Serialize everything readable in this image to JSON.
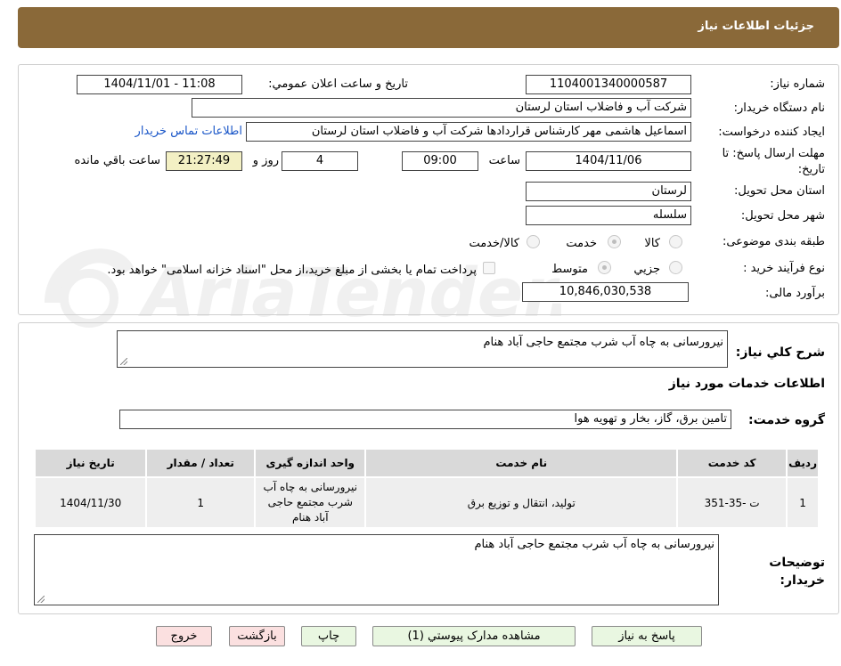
{
  "header": {
    "title": "جزئیات اطلاعات نیاز"
  },
  "form": {
    "need_number_label": "شماره نیاز:",
    "need_number": "1104001340000587",
    "announce_label": "تاریخ و ساعت اعلان عمومي:",
    "announce_value": "1404/11/01 - 11:08",
    "buyer_org_label": "نام دستگاه خریدار:",
    "buyer_org": "شرکت آب و فاضلاب استان لرستان",
    "creator_label": "ایجاد کننده درخواست:",
    "creator": "اسماعیل هاشمی مهر کارشناس قراردادها شرکت آب و فاضلاب استان لرستان",
    "contact_link": "اطلاعات تماس خریدار",
    "deadline_label": "مهلت ارسال پاسخ: تا تاریخ:",
    "deadline_date": "1404/11/06",
    "time_label": "ساعت",
    "deadline_time": "09:00",
    "days": "4",
    "days_label": "روز و",
    "remaining": "21:27:49",
    "remaining_label": "ساعت باقي مانده",
    "province_label": "استان محل تحویل:",
    "province": "لرستان",
    "city_label": "شهر محل تحویل:",
    "city": "سلسله",
    "category_label": "طبقه بندی موضوعی:",
    "category_options": [
      "کالا",
      "خدمت",
      "کالا/خدمت"
    ],
    "category_selected": "خدمت",
    "process_label": "نوع فرآیند خرید :",
    "process_options": [
      "جزیي",
      "متوسط"
    ],
    "process_selected": "متوسط",
    "payment_note": "پرداخت تمام یا بخشی از مبلغ خرید،از محل \"اسناد خزانه اسلامی\" خواهد بود.",
    "budget_label": "برآورد مالی:",
    "budget": "10,846,030,538"
  },
  "summary": {
    "label": "شرح کلي نیاز:",
    "text": "نیرورسانی به چاه آب شرب مجتمع حاجی آباد هنام"
  },
  "services": {
    "section_title": "اطلاعات خدمات مورد نیاز",
    "group_label": "گروه خدمت:",
    "group_value": "تامین برق، گاز، بخار و تهویه هوا",
    "columns": [
      "ردیف",
      "کد خدمت",
      "نام خدمت",
      "واحد اندازه گیری",
      "تعداد / مقدار",
      "تاریخ نیاز"
    ],
    "rows": [
      {
        "row": "1",
        "code": "ت -35-351",
        "name": "تولید، انتقال و توزیع برق",
        "unit": "نیرورسانی به چاه آب شرب مجتمع حاجی آباد هنام",
        "qty": "1",
        "date": "1404/11/30"
      }
    ]
  },
  "notes": {
    "label": "توضیحات خریدار:",
    "text": "نیرورسانی به چاه آب شرب مجتمع حاجی آباد هنام"
  },
  "buttons": {
    "reply": "پاسخ به نیاز",
    "attachments": "مشاهده مدارک پیوستي (1)",
    "print": "چاپ",
    "back": "بازگشت",
    "exit": "خروج"
  },
  "watermark": {
    "text": "AriaTender.net"
  },
  "colors": {
    "header_bg": "#8a6939",
    "link": "#1a56c8",
    "remaining_bg": "#f3f0c4",
    "button_green": "#e9f7e1",
    "button_pink": "#fbe0e0"
  }
}
